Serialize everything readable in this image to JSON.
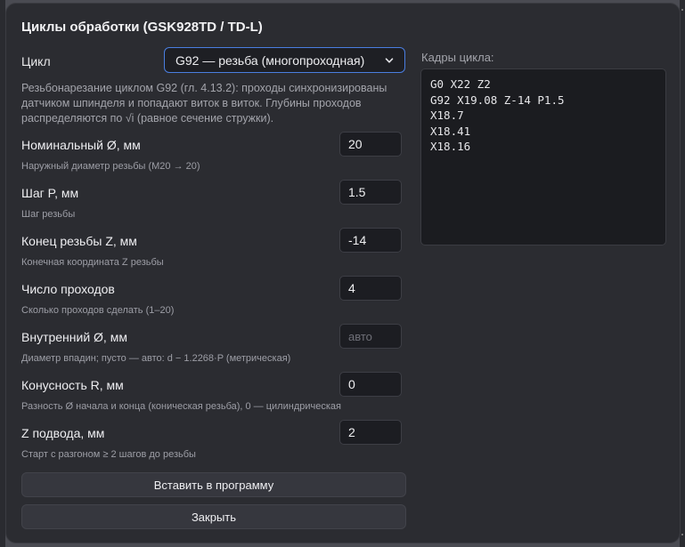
{
  "dialog": {
    "title": "Циклы обработки (GSK928TD / TD-L)"
  },
  "cycle": {
    "label": "Цикл",
    "selected": "G92 — резьба (многопроходная)",
    "description": "Резьбонарезание циклом G92 (гл. 4.13.2): проходы синхронизированы датчиком шпинделя и попадают виток в виток. Глубины проходов распределяются по √i (равное сечение стружки)."
  },
  "fields": [
    {
      "label": "Номинальный Ø, мм",
      "value": "20",
      "placeholder": "",
      "hint": "Наружный диаметр резьбы (M20 → 20)"
    },
    {
      "label": "Шаг P, мм",
      "value": "1.5",
      "placeholder": "",
      "hint": "Шаг резьбы"
    },
    {
      "label": "Конец резьбы Z, мм",
      "value": "-14",
      "placeholder": "",
      "hint": "Конечная координата Z резьбы"
    },
    {
      "label": "Число проходов",
      "value": "4",
      "placeholder": "",
      "hint": "Сколько проходов сделать (1–20)"
    },
    {
      "label": "Внутренний Ø, мм",
      "value": "",
      "placeholder": "авто",
      "hint": "Диаметр впадин; пусто — авто: d − 1.2268·P (метрическая)"
    },
    {
      "label": "Конусность R, мм",
      "value": "0",
      "placeholder": "",
      "hint": "Разность Ø начала и конца (коническая резьба), 0 — цилиндрическая"
    },
    {
      "label": "Z подвода, мм",
      "value": "2",
      "placeholder": "",
      "hint": "Старт с разгоном ≥ 2 шагов до резьбы"
    }
  ],
  "buttons": {
    "insert": "Вставить в программу",
    "close": "Закрыть"
  },
  "frames": {
    "label": "Кадры цикла:",
    "lines": [
      "G0 X22 Z2",
      "G92 X19.08 Z-14 P1.5",
      "X18.7",
      "X18.41",
      "X18.16"
    ]
  }
}
